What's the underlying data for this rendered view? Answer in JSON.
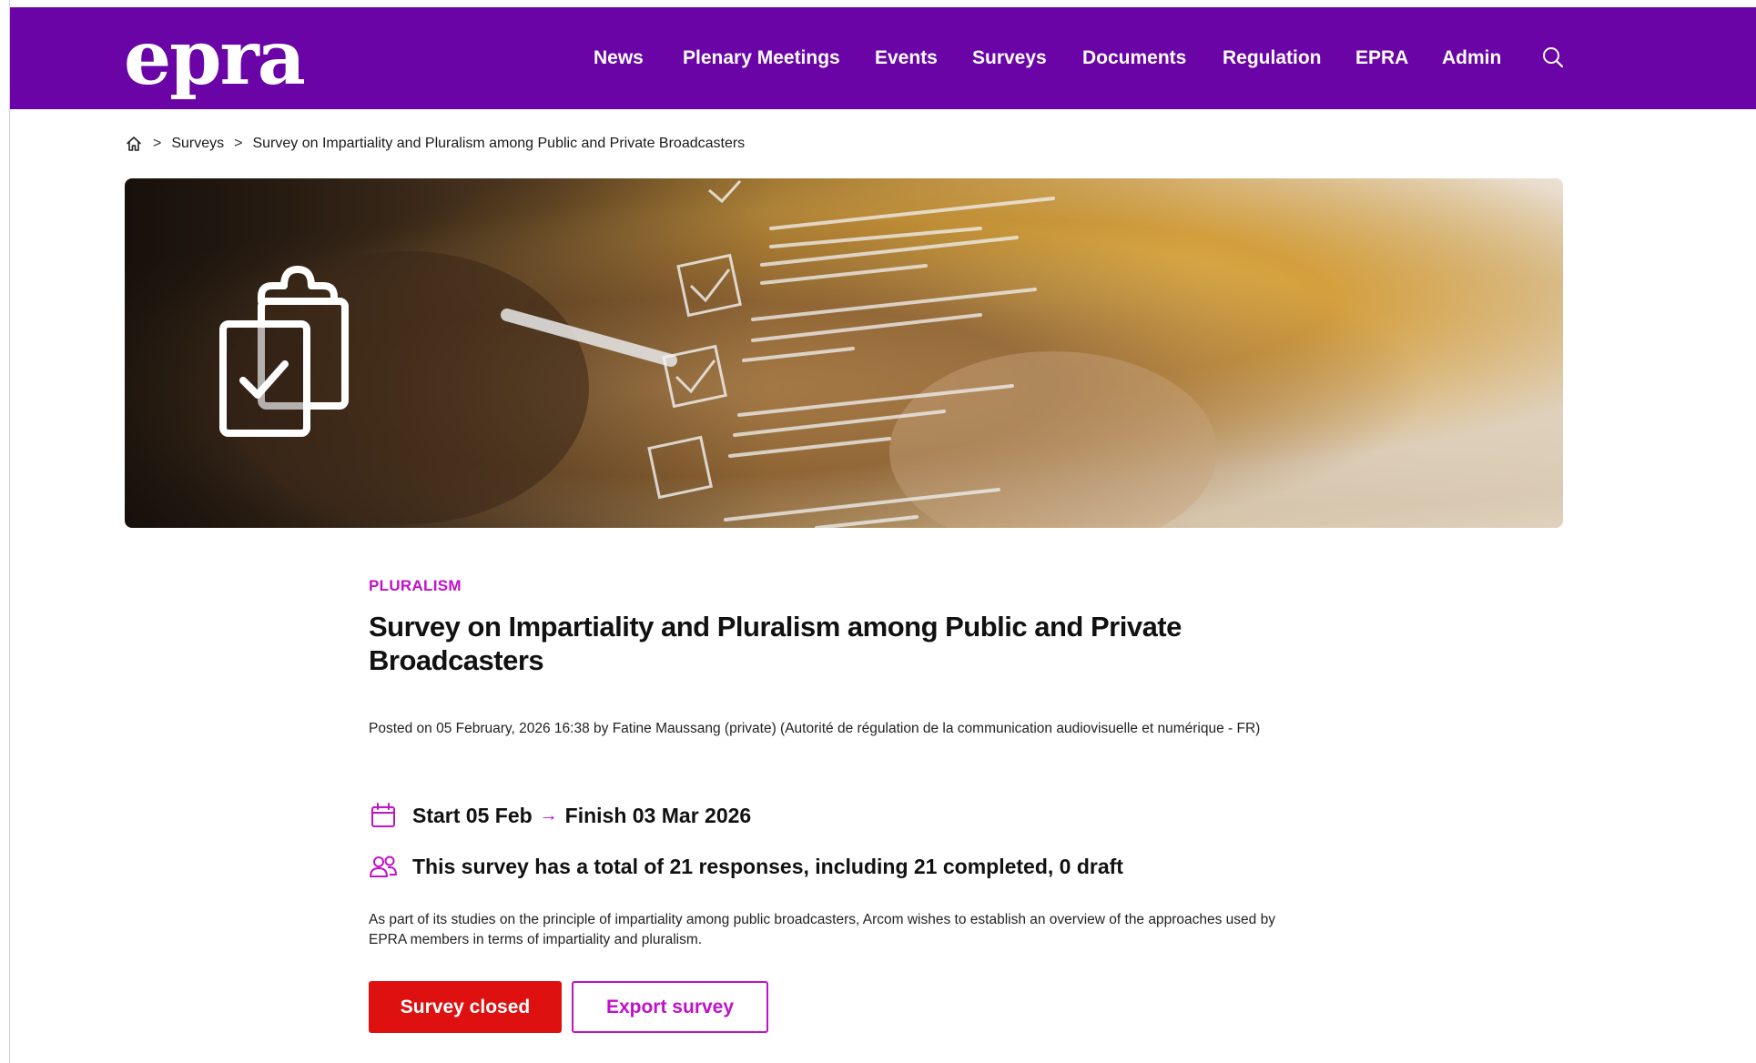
{
  "header": {
    "logo_text": "epra",
    "nav": [
      {
        "label": "News"
      },
      {
        "label": "Plenary Meetings"
      },
      {
        "label": "Events"
      },
      {
        "label": "Surveys"
      },
      {
        "label": "Documents"
      },
      {
        "label": "Regulation"
      },
      {
        "label": "EPRA"
      },
      {
        "label": "Admin"
      }
    ],
    "search_icon": "search-icon",
    "background_color": "#6a04a6"
  },
  "breadcrumb": {
    "home_icon": "home-icon",
    "separator": ">",
    "items": [
      "Surveys",
      "Survey on Impartiality and Pluralism among Public and Private Broadcasters"
    ]
  },
  "hero": {
    "icon": "clipboard-check-icon"
  },
  "survey": {
    "category": "PLURALISM",
    "title": "Survey on Impartiality and Pluralism among Public and Private Broadcasters",
    "posted": "Posted on 05 February, 2026 16:38 by Fatine Maussang (private) (Autorité de régulation de la communication audiovisuelle et numérique - FR)",
    "start": "Start 05 Feb",
    "arrow": "→",
    "finish": "Finish 03 Mar 2026",
    "responses": "This survey has a total of 21 responses, including 21 completed, 0 draft",
    "description": "As part of its studies on the principle of impartiality among public broadcasters, Arcom wishes to establish an overview of the approaches used by EPRA members in terms of impartiality and pluralism.",
    "calendar_icon": "calendar-icon",
    "users_icon": "users-icon"
  },
  "actions": {
    "closed_label": "Survey closed",
    "export_label": "Export survey"
  },
  "colors": {
    "brand_purple": "#6a04a6",
    "accent_magenta": "#c012c8",
    "closed_red": "#de1010"
  }
}
